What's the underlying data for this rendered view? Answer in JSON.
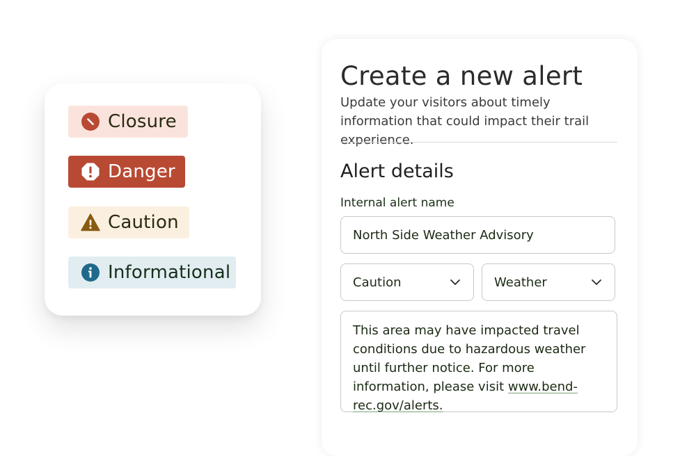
{
  "badges": [
    {
      "label": "Closure",
      "icon": "closure-icon",
      "bg": "#fbe3dd",
      "icon_color": "#b84a34"
    },
    {
      "label": "Danger",
      "icon": "danger-icon",
      "bg": "#b84a34",
      "icon_color": "#ffffff"
    },
    {
      "label": "Caution",
      "icon": "caution-icon",
      "bg": "#fbf0df",
      "icon_color": "#8a5a12"
    },
    {
      "label": "Informational",
      "icon": "info-icon",
      "bg": "#e2edf1",
      "icon_color": "#1f6a8c"
    }
  ],
  "form": {
    "title": "Create a new alert",
    "subtitle": "Update your visitors about timely information that could impact their trail experience.",
    "section_title": "Alert details",
    "name_label": "Internal alert name",
    "name_value": "North Side Weather Advisory",
    "severity_value": "Caution",
    "category_value": "Weather",
    "message_text": "This area may have impacted travel conditions due to hazardous weather until further notice. For more information, please visit",
    "message_link": "www.bend-rec.gov/alerts."
  }
}
